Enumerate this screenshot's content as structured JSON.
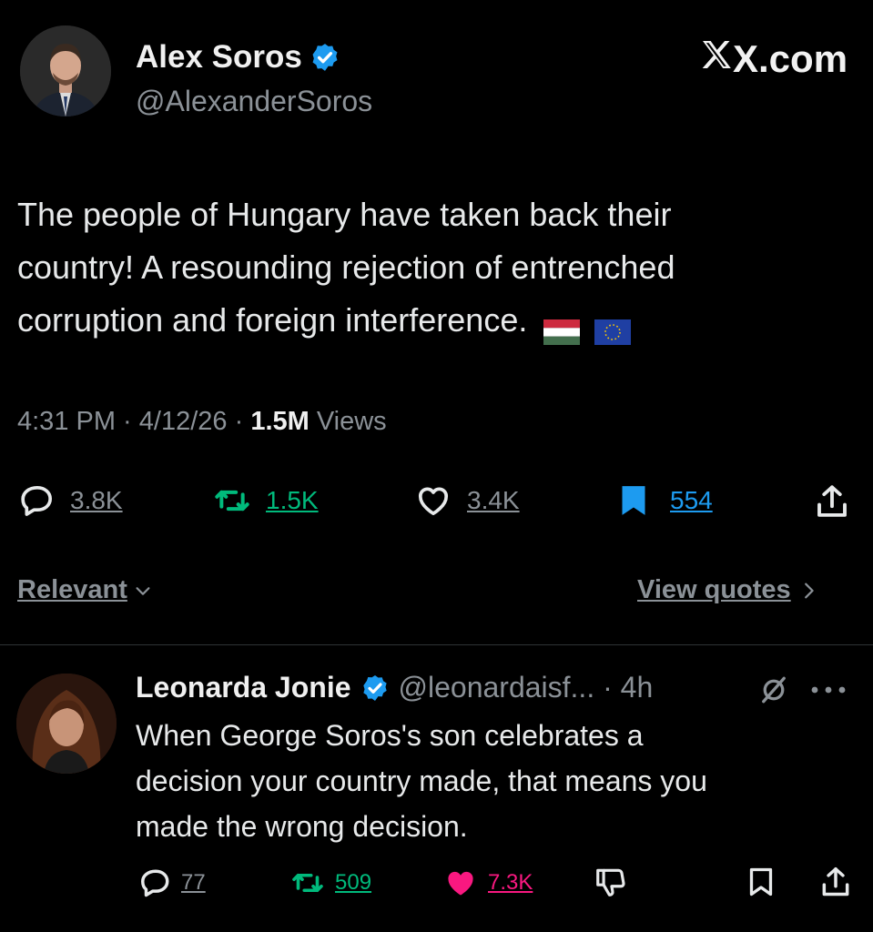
{
  "brand": {
    "label": "X.com"
  },
  "tweet": {
    "author_name": "Alex Soros",
    "author_handle": "@AlexanderSoros",
    "text_lines": [
      "The people of Hungary have taken back their",
      "country! A resounding rejection of entrenched",
      "corruption and foreign interference."
    ],
    "time": "4:31 PM · 4/12/26 · ",
    "views_count": "1.5M",
    "views_label": " Views",
    "replies": "3.8K",
    "reposts": "1.5K",
    "likes": "3.4K",
    "bookmarks": "554"
  },
  "filter": {
    "sort_label": "Relevant",
    "quotes_label": "View quotes"
  },
  "reply": {
    "author_name": "Leonarda Jonie",
    "author_handle": "@leonardaisf... · 4h",
    "text_lines": [
      "When George Soros's son celebrates a",
      "decision your country made, that means you",
      "made the wrong decision."
    ],
    "replies": "77",
    "reposts": "509",
    "likes": "7.3K"
  },
  "colors": {
    "background": "#000000",
    "verified": "#1d9bf0",
    "repost_green": "#00ba7c",
    "like_pink": "#f91880",
    "bookmark_blue": "#1d9bf0"
  }
}
